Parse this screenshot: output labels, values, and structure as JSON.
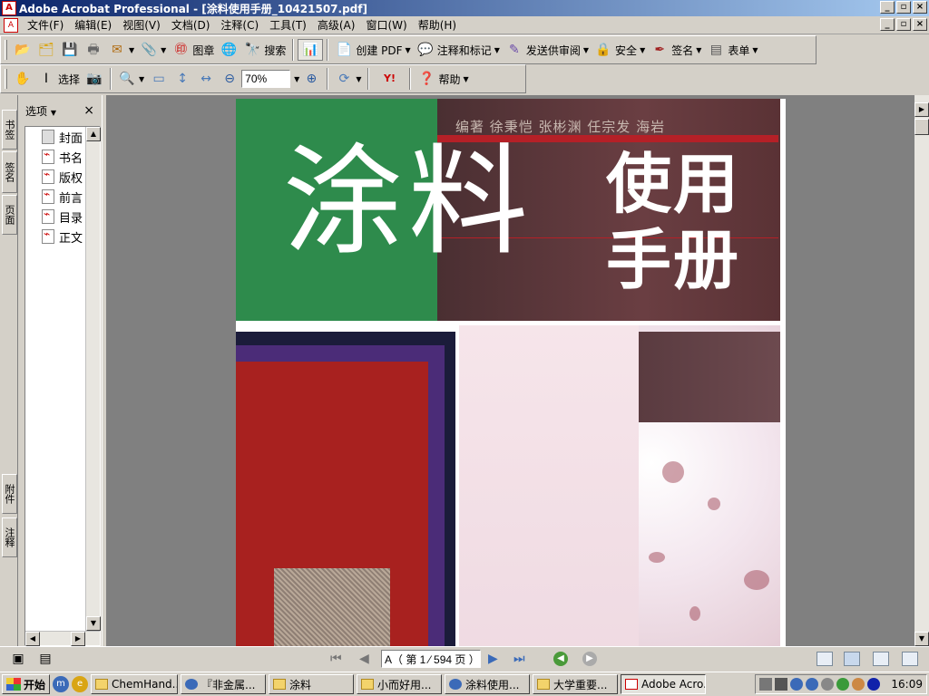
{
  "window": {
    "title": "Adobe Acrobat Professional - [涂料使用手册_10421507.pdf]",
    "btn_min": "_",
    "btn_restore": "▫",
    "btn_close": "×"
  },
  "menu": [
    "文件(F)",
    "编辑(E)",
    "视图(V)",
    "文档(D)",
    "注释(C)",
    "工具(T)",
    "高级(A)",
    "窗口(W)",
    "帮助(H)"
  ],
  "toolbar1": {
    "stamp": "图章",
    "search": "搜索",
    "create_pdf": "创建 PDF",
    "comment": "注释和标记",
    "review": "发送供审阅",
    "security": "安全",
    "sign": "签名",
    "forms": "表单"
  },
  "toolbar2": {
    "select": "选择",
    "zoom_value": "70%",
    "help": "帮助"
  },
  "navigation": {
    "options_label": "选项",
    "close": "×",
    "tabs": [
      "书签",
      "签名",
      "页面"
    ],
    "bottom_tabs": [
      "附件",
      "注释"
    ],
    "items": [
      {
        "label": "封面",
        "icon": "plain-page-icon"
      },
      {
        "label": "书名",
        "icon": "pdf-page-icon"
      },
      {
        "label": "版权",
        "icon": "pdf-page-icon"
      },
      {
        "label": "前言",
        "icon": "pdf-page-icon"
      },
      {
        "label": "目录",
        "icon": "pdf-page-icon"
      },
      {
        "label": "正文",
        "icon": "pdf-page-icon"
      }
    ]
  },
  "document": {
    "authors": "编著  徐秉恺  张彬渊  任宗发  海岩",
    "title_main": "涂料",
    "title_sub": "使用手册"
  },
  "status": {
    "page_indicator": "A（ 第 1 ⁄ 594 页 ）"
  },
  "taskbar": {
    "start": "开始",
    "tasks": [
      {
        "label": "ChemHand...",
        "icon": "folder"
      },
      {
        "label": "『非金属...",
        "icon": "maxthon"
      },
      {
        "label": "涂料",
        "icon": "folder"
      },
      {
        "label": "小而好用...",
        "icon": "folder"
      },
      {
        "label": "涂料使用...",
        "icon": "maxthon"
      },
      {
        "label": "大学重要...",
        "icon": "folder"
      },
      {
        "label": "Adobe Acro...",
        "icon": "acrobat",
        "active": true
      }
    ],
    "clock": "16:09"
  }
}
